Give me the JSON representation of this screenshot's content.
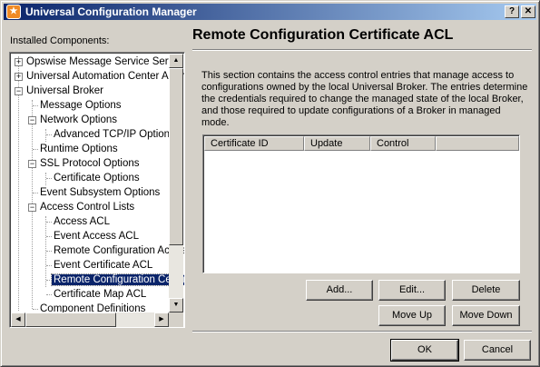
{
  "window": {
    "title": "Universal Configuration Manager",
    "help_label": "?",
    "close_label": "✕"
  },
  "left": {
    "label": "Installed Components:"
  },
  "tree": {
    "items": [
      {
        "label": "Opswise Message Service Server",
        "expander": "+"
      },
      {
        "label": "Universal Automation Center Agent",
        "expander": "+"
      },
      {
        "label": "Universal Broker",
        "expander": "−"
      },
      {
        "label": "Message Options"
      },
      {
        "label": "Network Options",
        "expander": "−"
      },
      {
        "label": "Advanced TCP/IP Options"
      },
      {
        "label": "Runtime Options"
      },
      {
        "label": "SSL Protocol Options",
        "expander": "−"
      },
      {
        "label": "Certificate Options"
      },
      {
        "label": "Event Subsystem Options"
      },
      {
        "label": "Access Control Lists",
        "expander": "−"
      },
      {
        "label": "Access ACL"
      },
      {
        "label": "Event Access ACL"
      },
      {
        "label": "Remote Configuration Access ACL"
      },
      {
        "label": "Event Certificate ACL"
      },
      {
        "label": "Remote Configuration Certificate ACL",
        "selected": true
      },
      {
        "label": "Certificate Map ACL"
      },
      {
        "label": "Component Definitions"
      }
    ]
  },
  "panel": {
    "title": "Remote Configuration Certificate ACL",
    "description": "This section contains the access control entries that manage access to configurations owned by the local Universal Broker.  The entries determine the credentials required to change the managed state of the local Broker, and those required to update configurations of a Broker in managed mode."
  },
  "table": {
    "columns": [
      "Certificate ID",
      "Update",
      "Control"
    ],
    "rows": []
  },
  "buttons": {
    "add": "Add...",
    "edit": "Edit...",
    "delete": "Delete",
    "move_up": "Move Up",
    "move_down": "Move Down",
    "ok": "OK",
    "cancel": "Cancel"
  },
  "icons": {
    "app": "ucm-app-icon",
    "scroll_up": "arrow-up-icon",
    "scroll_down": "arrow-down-icon",
    "scroll_left": "arrow-left-icon",
    "scroll_right": "arrow-right-icon"
  },
  "colors": {
    "title_start": "#0a246a",
    "title_end": "#a6caf0",
    "selection": "#0a246a",
    "face": "#d4d0c8"
  }
}
